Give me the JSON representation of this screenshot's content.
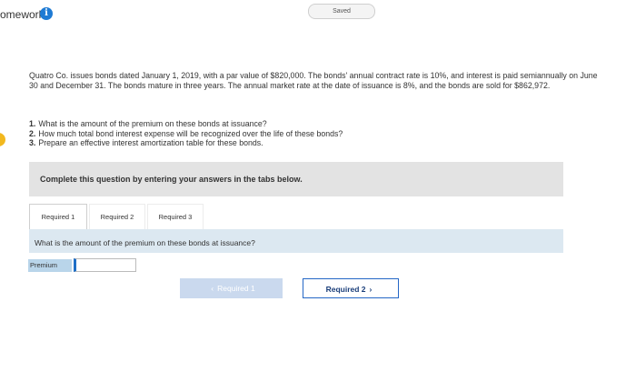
{
  "header": {
    "title": "omework",
    "info_icon": "i",
    "saved_label": "Saved"
  },
  "question": {
    "text": "Quatro Co. issues bonds dated January 1, 2019, with a par value of $820,000. The bonds' annual contract rate is 10%, and interest is paid semiannually on June 30 and December 31. The bonds mature in three years. The annual market rate at the date of issuance is 8%, and the bonds are sold for $862,972.",
    "tasks": [
      {
        "num": "1.",
        "text": "What is the amount of the premium on these bonds at issuance?"
      },
      {
        "num": "2.",
        "text": "How much total bond interest expense will be recognized over the life of these bonds?"
      },
      {
        "num": "3.",
        "text": "Prepare an effective interest amortization table for these bonds."
      }
    ]
  },
  "instruction": "Complete this question by entering your answers in the tabs below.",
  "tabs": [
    {
      "label": "Required 1"
    },
    {
      "label": "Required 2"
    },
    {
      "label": "Required 3"
    }
  ],
  "prompt": "What is the amount of the premium on these bonds at issuance?",
  "premium": {
    "label": "Premium",
    "value": ""
  },
  "nav": {
    "prev_label": "Required 1",
    "next_label": "Required 2"
  },
  "colors": {
    "accent": "#2467c6",
    "marker": "#f2b81e",
    "prompt_bg": "#dce8f1"
  }
}
